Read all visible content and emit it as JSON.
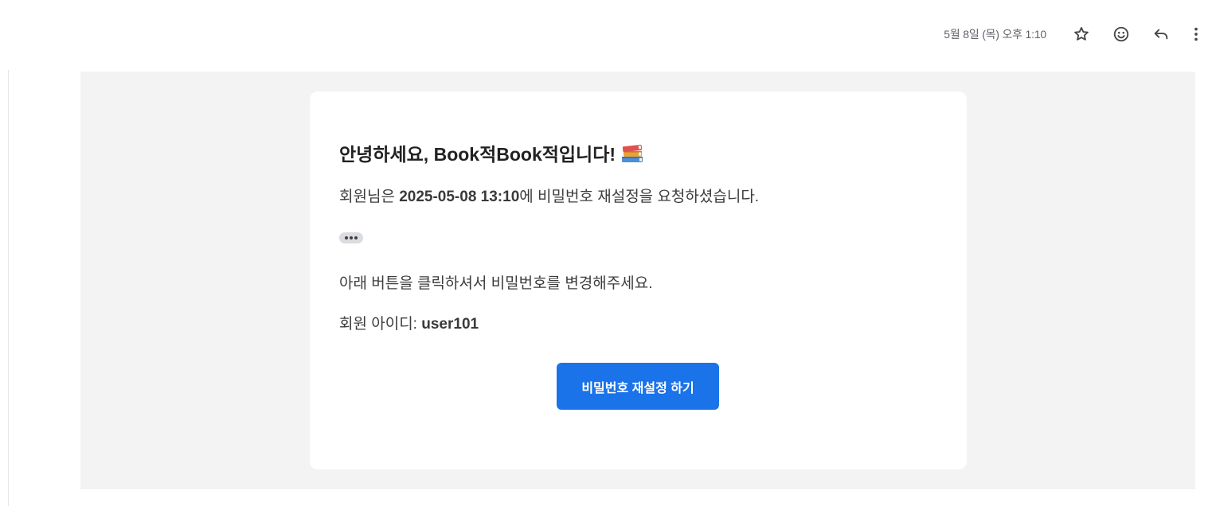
{
  "header": {
    "timestamp": "5월 8일 (목) 오후 1:10",
    "icons": [
      "star-icon",
      "emoji-icon",
      "reply-icon",
      "more-vert-icon"
    ]
  },
  "email": {
    "greeting": "안녕하세요, Book적Book적입니다!",
    "greeting_emoji": "books-icon",
    "line1_prefix": "회원님은 ",
    "line1_datetime": "2025-05-08 13:10",
    "line1_suffix": "에 비밀번호 재설정을 요청하셨습니다.",
    "instruction": "아래 버튼을 클릭하셔서 비밀번호를 변경해주세요.",
    "member_id_label": "회원 아이디: ",
    "member_id": "user101",
    "reset_button_label": "비밀번호 재설정 하기"
  },
  "colors": {
    "button": "#1a73e8",
    "email_background": "#f3f3f3",
    "card_background": "#ffffff",
    "secondary_text": "#5f6368"
  }
}
